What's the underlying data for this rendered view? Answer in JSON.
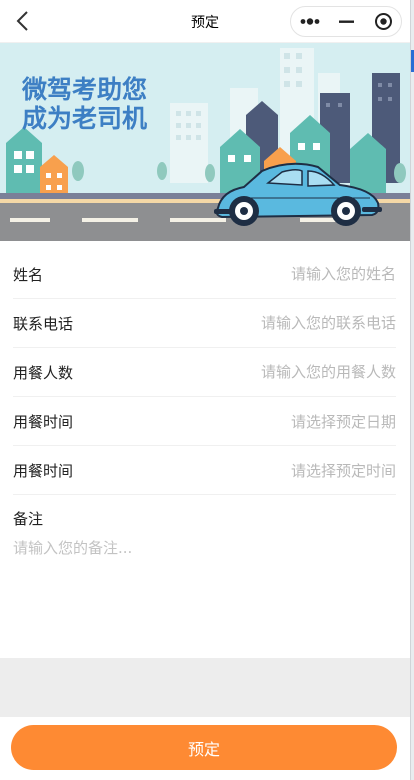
{
  "navbar": {
    "title": "预定",
    "back_icon": "chevron-left-icon",
    "more_icon": "more-dots-icon",
    "minimize_icon": "minimize-icon",
    "close_icon": "target-circle-icon"
  },
  "banner": {
    "line1": "微驾考助您",
    "line2": "成为老司机"
  },
  "form": {
    "name": {
      "label": "姓名",
      "placeholder": "请输入您的姓名"
    },
    "phone": {
      "label": "联系电话",
      "placeholder": "请输入您的联系电话"
    },
    "people": {
      "label": "用餐人数",
      "placeholder": "请输入您的用餐人数"
    },
    "date": {
      "label": "用餐时间",
      "placeholder": "请选择预定日期"
    },
    "time": {
      "label": "用餐时间",
      "placeholder": "请选择预定时间"
    },
    "notes": {
      "label": "备注",
      "placeholder": "请输入您的备注..."
    }
  },
  "submit": {
    "label": "预定"
  },
  "colors": {
    "accent": "#fe8a33",
    "banner_text": "#3d7fc4",
    "car": "#5ab9df"
  }
}
